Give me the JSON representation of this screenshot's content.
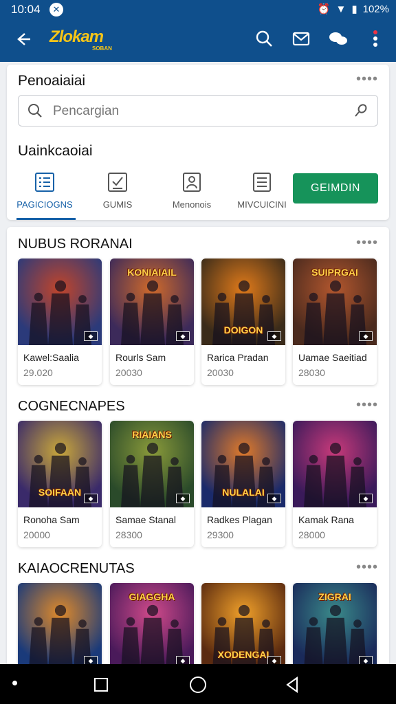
{
  "status": {
    "time": "10:04",
    "battery": "102%"
  },
  "app": {
    "logo": "Zlokam",
    "logo_sub": "SOBAN"
  },
  "search_section": {
    "title": "Penoaiaiai",
    "placeholder": "Pencargian",
    "category_title": "Uainkcaoiai",
    "tabs": [
      {
        "label": "PAGICIOGNS",
        "icon": "list-icon",
        "active": true
      },
      {
        "label": "GUMIS",
        "icon": "checklist-icon",
        "active": false
      },
      {
        "label": "Menonois",
        "icon": "profile-icon",
        "active": false
      },
      {
        "label": "MIVCUICINI",
        "icon": "document-icon",
        "active": false
      }
    ],
    "button": "GEIMDIN"
  },
  "sections": [
    {
      "title": "NUBUS RORANAI",
      "games": [
        {
          "name": "Kawel:Saalia",
          "num": "29.020",
          "art_text": "",
          "colors": [
            "#2b3a7a",
            "#c2452a"
          ]
        },
        {
          "name": "Rourls Sam",
          "num": "20030",
          "art_text": "KONIAIAIL",
          "colors": [
            "#3c2a5a",
            "#d06a2a"
          ]
        },
        {
          "name": "Rarica Pradan",
          "num": "20030",
          "art_text": "DOIGON",
          "colors": [
            "#3a2b1a",
            "#e07a1a"
          ]
        },
        {
          "name": "Uamae Saeitiad",
          "num": "28030",
          "art_text": "SUIPRGAI",
          "colors": [
            "#4a2a1e",
            "#b3572e"
          ]
        }
      ]
    },
    {
      "title": "COGNECNAPES",
      "games": [
        {
          "name": "Ronoha Sam",
          "num": "20000",
          "art_text": "SOIFAAN",
          "colors": [
            "#3a2a6a",
            "#caa83a"
          ]
        },
        {
          "name": "Samae Stanal",
          "num": "28300",
          "art_text": "RIAIANS",
          "colors": [
            "#2a4a2a",
            "#8a9a3a"
          ]
        },
        {
          "name": "Radkes Plagan",
          "num": "29300",
          "art_text": "NULALAI",
          "colors": [
            "#1a2a6a",
            "#e07a2a"
          ]
        },
        {
          "name": "Kamak Rana",
          "num": "28000",
          "art_text": "",
          "colors": [
            "#3a1a5a",
            "#c83a7a"
          ]
        }
      ]
    },
    {
      "title": "KAIAOCRENUTAS",
      "games": [
        {
          "name": "",
          "num": "",
          "art_text": "",
          "colors": [
            "#1a3a7a",
            "#e08a2a"
          ]
        },
        {
          "name": "",
          "num": "",
          "art_text": "GIAGGHA",
          "colors": [
            "#4a1a5a",
            "#d04a8a"
          ]
        },
        {
          "name": "",
          "num": "",
          "art_text": "XODENGAI",
          "colors": [
            "#5a2a10",
            "#f0a02a"
          ]
        },
        {
          "name": "",
          "num": "",
          "art_text": "ZIGRAI",
          "colors": [
            "#1a2a5a",
            "#3a8a8a"
          ]
        }
      ]
    }
  ]
}
